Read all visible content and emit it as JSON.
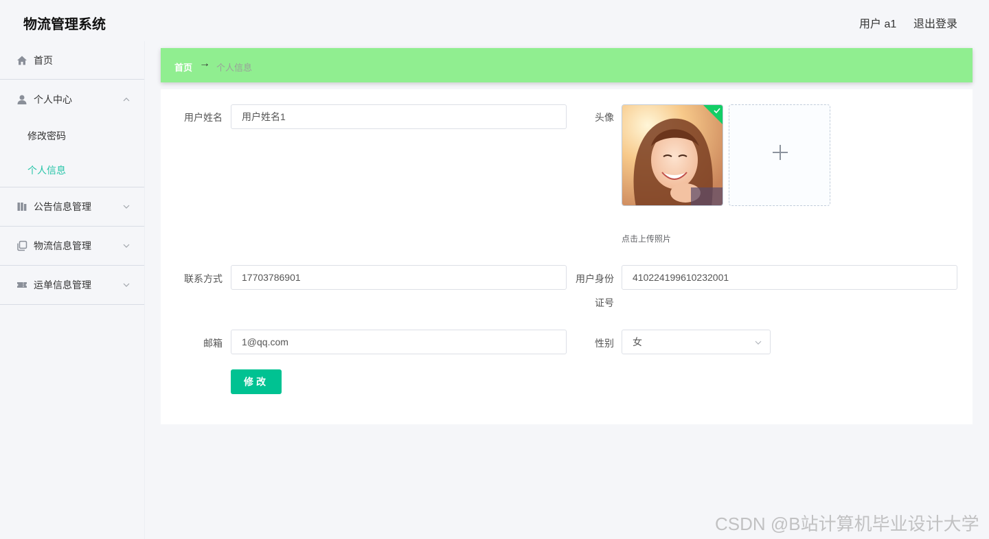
{
  "header": {
    "title": "物流管理系统",
    "user_label": "用户 a1",
    "logout_label": "退出登录"
  },
  "sidebar": {
    "items": [
      {
        "label": "首页",
        "icon": "home-icon"
      },
      {
        "label": "个人中心",
        "icon": "user-icon",
        "expanded": true,
        "children": [
          {
            "label": "修改密码",
            "active": false
          },
          {
            "label": "个人信息",
            "active": true
          }
        ]
      },
      {
        "label": "公告信息管理",
        "icon": "notice-icon",
        "expanded": false
      },
      {
        "label": "物流信息管理",
        "icon": "copy-icon",
        "expanded": false
      },
      {
        "label": "运单信息管理",
        "icon": "ticket-icon",
        "expanded": false
      }
    ]
  },
  "breadcrumb": {
    "home": "首页",
    "separator": "→",
    "current": "个人信息"
  },
  "form": {
    "username": {
      "label": "用户姓名",
      "value": "用户姓名1"
    },
    "avatar": {
      "label": "头像",
      "tip": "点击上传照片"
    },
    "phone": {
      "label": "联系方式",
      "value": "17703786901"
    },
    "idcard": {
      "label_line1": "用户身份",
      "label_line2": "证号",
      "value": "410224199610232001"
    },
    "email": {
      "label": "邮箱",
      "value": "1@qq.com"
    },
    "gender": {
      "label": "性别",
      "value": "女"
    },
    "submit_label": "修改"
  },
  "watermark": "CSDN @B站计算机毕业设计大学",
  "colors": {
    "accent": "#00c292",
    "active_menu": "#26c4a8",
    "breadcrumb_bg": "#90ee90",
    "success_badge": "#13ce66"
  }
}
